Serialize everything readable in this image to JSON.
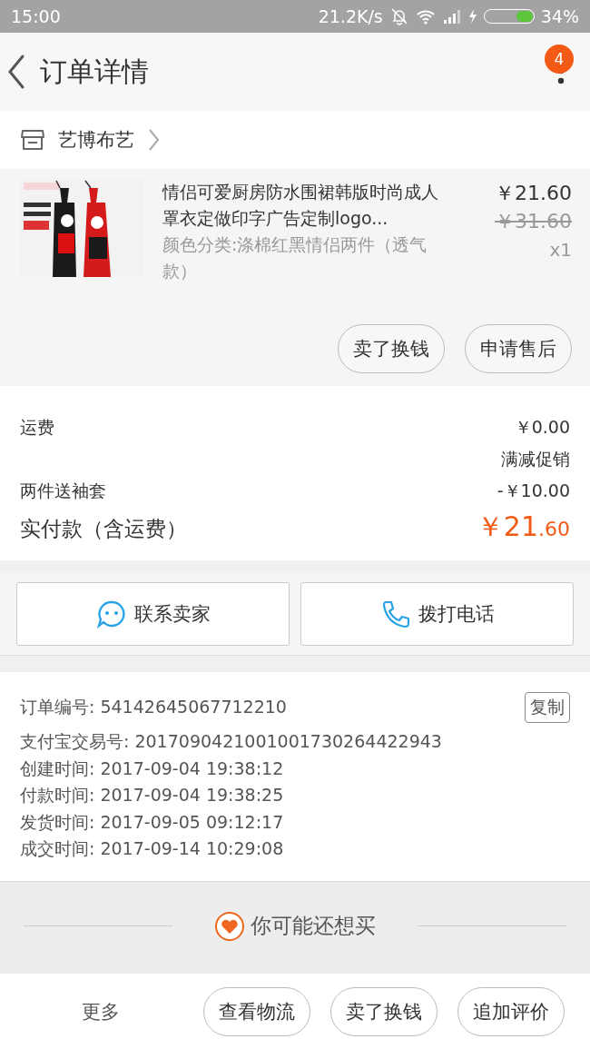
{
  "status_bar": {
    "time": "15:00",
    "speed": "21.2K/s",
    "battery": "34%"
  },
  "header": {
    "title": "订单详情",
    "badge": "4"
  },
  "shop": {
    "name": "艺博布艺"
  },
  "product": {
    "title": "情侣可爱厨房防水围裙韩版时尚成人罩衣定做印字广告定制logo...",
    "sku": "颜色分类:涤棉红黑情侣两件（透气款）",
    "price": "￥21.60",
    "original_price": "￥31.60",
    "quantity": "x1",
    "actions": [
      "卖了换钱",
      "申请售后"
    ]
  },
  "fees": [
    {
      "label": "运费",
      "value": "￥0.00"
    },
    {
      "value": "满减促销"
    },
    {
      "label": "两件送袖套",
      "value": "-￥10.00"
    }
  ],
  "total": {
    "label": "实付款（含运费）",
    "integer": "￥21",
    "decimal": ".60"
  },
  "contact_buttons": [
    {
      "kind": "chat",
      "label": "联系卖家"
    },
    {
      "kind": "phone",
      "label": "拨打电话"
    }
  ],
  "order_info": {
    "rows": [
      {
        "label": "订单编号:",
        "value": "54142645067712210"
      },
      {
        "label": "支付宝交易号:",
        "value": "2017090421001001730264422943"
      },
      {
        "label": "创建时间:",
        "value": "2017-09-04 19:38:12"
      },
      {
        "label": "付款时间:",
        "value": "2017-09-04 19:38:25"
      },
      {
        "label": "发货时间:",
        "value": "2017-09-05 09:12:17"
      },
      {
        "label": "成交时间:",
        "value": "2017-09-14 10:29:08"
      }
    ],
    "copy_button": "复制"
  },
  "recommend": {
    "title": "你可能还想买"
  },
  "bottom_bar": {
    "more": "更多",
    "buttons": [
      "查看物流",
      "卖了换钱",
      "追加评价"
    ]
  }
}
